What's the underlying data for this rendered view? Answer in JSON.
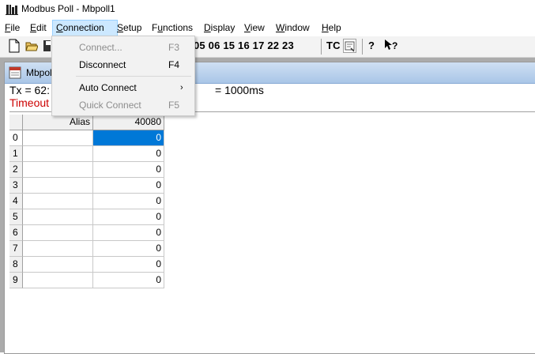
{
  "window": {
    "title": "Modbus Poll - Mbpoll1"
  },
  "menu": [
    {
      "label": "File",
      "u": "F",
      "rest": "ile"
    },
    {
      "label": "Edit",
      "u": "E",
      "rest": "dit"
    },
    {
      "label": "Connection",
      "u": "C",
      "rest": "onnection"
    },
    {
      "label": "Setup",
      "u": "S",
      "rest": "etup"
    },
    {
      "label": "Functions",
      "u": "u",
      "pre": "F",
      "rest": "nctions"
    },
    {
      "label": "Display",
      "u": "D",
      "rest": "isplay"
    },
    {
      "label": "View",
      "u": "V",
      "rest": "iew"
    },
    {
      "label": "Window",
      "u": "W",
      "rest": "indow"
    },
    {
      "label": "Help",
      "u": "H",
      "rest": "elp"
    }
  ],
  "toolbar": {
    "function_codes": "05 06 15 16 17 22 23",
    "tc": "TC"
  },
  "connection_menu": {
    "items": [
      {
        "label": "Connect...",
        "shortcut": "F3",
        "enabled": false
      },
      {
        "label": "Disconnect",
        "shortcut": "F4",
        "enabled": true
      },
      {
        "label": "Auto Connect",
        "shortcut": "",
        "enabled": true,
        "submenu": true
      },
      {
        "label": "Quick Connect",
        "shortcut": "F5",
        "enabled": false
      }
    ]
  },
  "child_window": {
    "title": "Mbpoll",
    "tx_line": "Tx = 62:",
    "scan_rate": "= 1000ms",
    "status": "Timeout"
  },
  "grid": {
    "headers": {
      "alias": "Alias",
      "address": "40080"
    },
    "rows": [
      {
        "index": "0",
        "alias": "",
        "value": "0"
      },
      {
        "index": "1",
        "alias": "",
        "value": "0"
      },
      {
        "index": "2",
        "alias": "",
        "value": "0"
      },
      {
        "index": "3",
        "alias": "",
        "value": "0"
      },
      {
        "index": "4",
        "alias": "",
        "value": "0"
      },
      {
        "index": "5",
        "alias": "",
        "value": "0"
      },
      {
        "index": "6",
        "alias": "",
        "value": "0"
      },
      {
        "index": "7",
        "alias": "",
        "value": "0"
      },
      {
        "index": "8",
        "alias": "",
        "value": "0"
      },
      {
        "index": "9",
        "alias": "",
        "value": "0"
      }
    ]
  },
  "colors": {
    "selection": "#0078d7",
    "menu_highlight": "#cce8ff",
    "timeout_text": "#cc0000"
  }
}
